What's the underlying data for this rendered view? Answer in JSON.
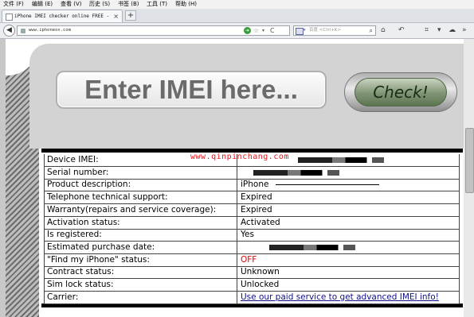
{
  "menu": [
    "文件 (F)",
    "编辑 (E)",
    "查看 (V)",
    "历史 (S)",
    "书签 (B)",
    "工具 (T)",
    "帮助 (H)"
  ],
  "tab": {
    "title": "iPhone IMEI checker online FREE - i…",
    "close": "×",
    "new_tab": "+"
  },
  "nav": {
    "back": "◀",
    "url": "www.iphoneox.com",
    "go": "➜",
    "star": "☆",
    "dropdown": "▾",
    "reload": "C",
    "search_placeholder": "百度 <Ctrl+K>",
    "engine_arrow": "▾",
    "search_icon": "⌕",
    "home": "⌂",
    "history_back": "↶",
    "crop": "⌗",
    "menu_arrow": "▾",
    "chat": "☁",
    "more": "»"
  },
  "hero": {
    "input_text": "Enter IMEI here...",
    "button_label": "Check!"
  },
  "watermark": "www.qinpinchang.com",
  "results": {
    "rows": [
      {
        "label": "Device IMEI:",
        "value": "",
        "redacted": true
      },
      {
        "label": "Serial number:",
        "value": "",
        "redacted": true
      },
      {
        "label": "Product description:",
        "value": "iPhone",
        "redacted": true
      },
      {
        "label": "Telephone technical support:",
        "value": "Expired"
      },
      {
        "label": "Warranty(repairs and service coverage):",
        "value": "Expired"
      },
      {
        "label": "Activation status:",
        "value": "Activated"
      },
      {
        "label": "Is registered:",
        "value": "Yes"
      },
      {
        "label": "Estimated purchase date:",
        "value": "",
        "redacted": true
      },
      {
        "label": "\"Find my iPhone\" status:",
        "value": "OFF",
        "status": "off"
      },
      {
        "label": "Contract status:",
        "value": "Unknown"
      },
      {
        "label": "Sim lock status:",
        "value": "Unlocked"
      },
      {
        "label": "Carrier:",
        "value": "Use our paid service to get advanced IMEI info!",
        "status": "link"
      }
    ]
  },
  "colors": {
    "off": "#e20000",
    "link": "#10108a",
    "watermark": "#e8151d",
    "check_button": "#7f9473"
  }
}
